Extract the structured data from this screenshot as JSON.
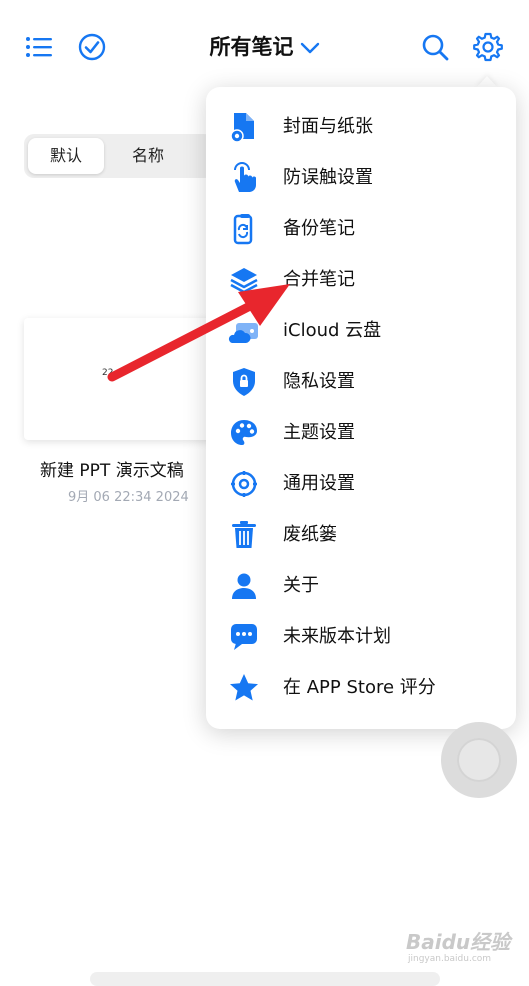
{
  "header": {
    "title": "所有笔记",
    "icons": [
      "list-icon",
      "check-circle-icon",
      "chevron-down-icon",
      "search-icon",
      "gear-icon"
    ]
  },
  "sort_tabs": [
    {
      "label": "默认",
      "active": true
    },
    {
      "label": "名称",
      "active": false
    }
  ],
  "note": {
    "thumbnail_text": "22",
    "title": "新建 PPT 演示文稿",
    "date": "9月 06 22:34 2024"
  },
  "menu": {
    "items": [
      {
        "label": "封面与纸张",
        "icon": "file-gear-icon"
      },
      {
        "label": "防误触设置",
        "icon": "hand-tap-icon"
      },
      {
        "label": "备份笔记",
        "icon": "phone-sync-icon"
      },
      {
        "label": "合并笔记",
        "icon": "layers-icon"
      },
      {
        "label": "iCloud 云盘",
        "icon": "cloud-drive-icon"
      },
      {
        "label": "隐私设置",
        "icon": "shield-lock-icon"
      },
      {
        "label": "主题设置",
        "icon": "palette-icon"
      },
      {
        "label": "通用设置",
        "icon": "settings-icon"
      },
      {
        "label": "废纸篓",
        "icon": "trash-icon"
      },
      {
        "label": "关于",
        "icon": "person-icon"
      },
      {
        "label": "未来版本计划",
        "icon": "chat-bubble-icon"
      },
      {
        "label": "在 APP Store 评分",
        "icon": "star-icon"
      }
    ]
  },
  "watermark": {
    "text": "Baidu经验",
    "sub": "jingyan.baidu.com"
  },
  "colors": {
    "accent": "#1677f2",
    "arrow": "#e8262d",
    "date_gray": "#a3a9b4"
  }
}
